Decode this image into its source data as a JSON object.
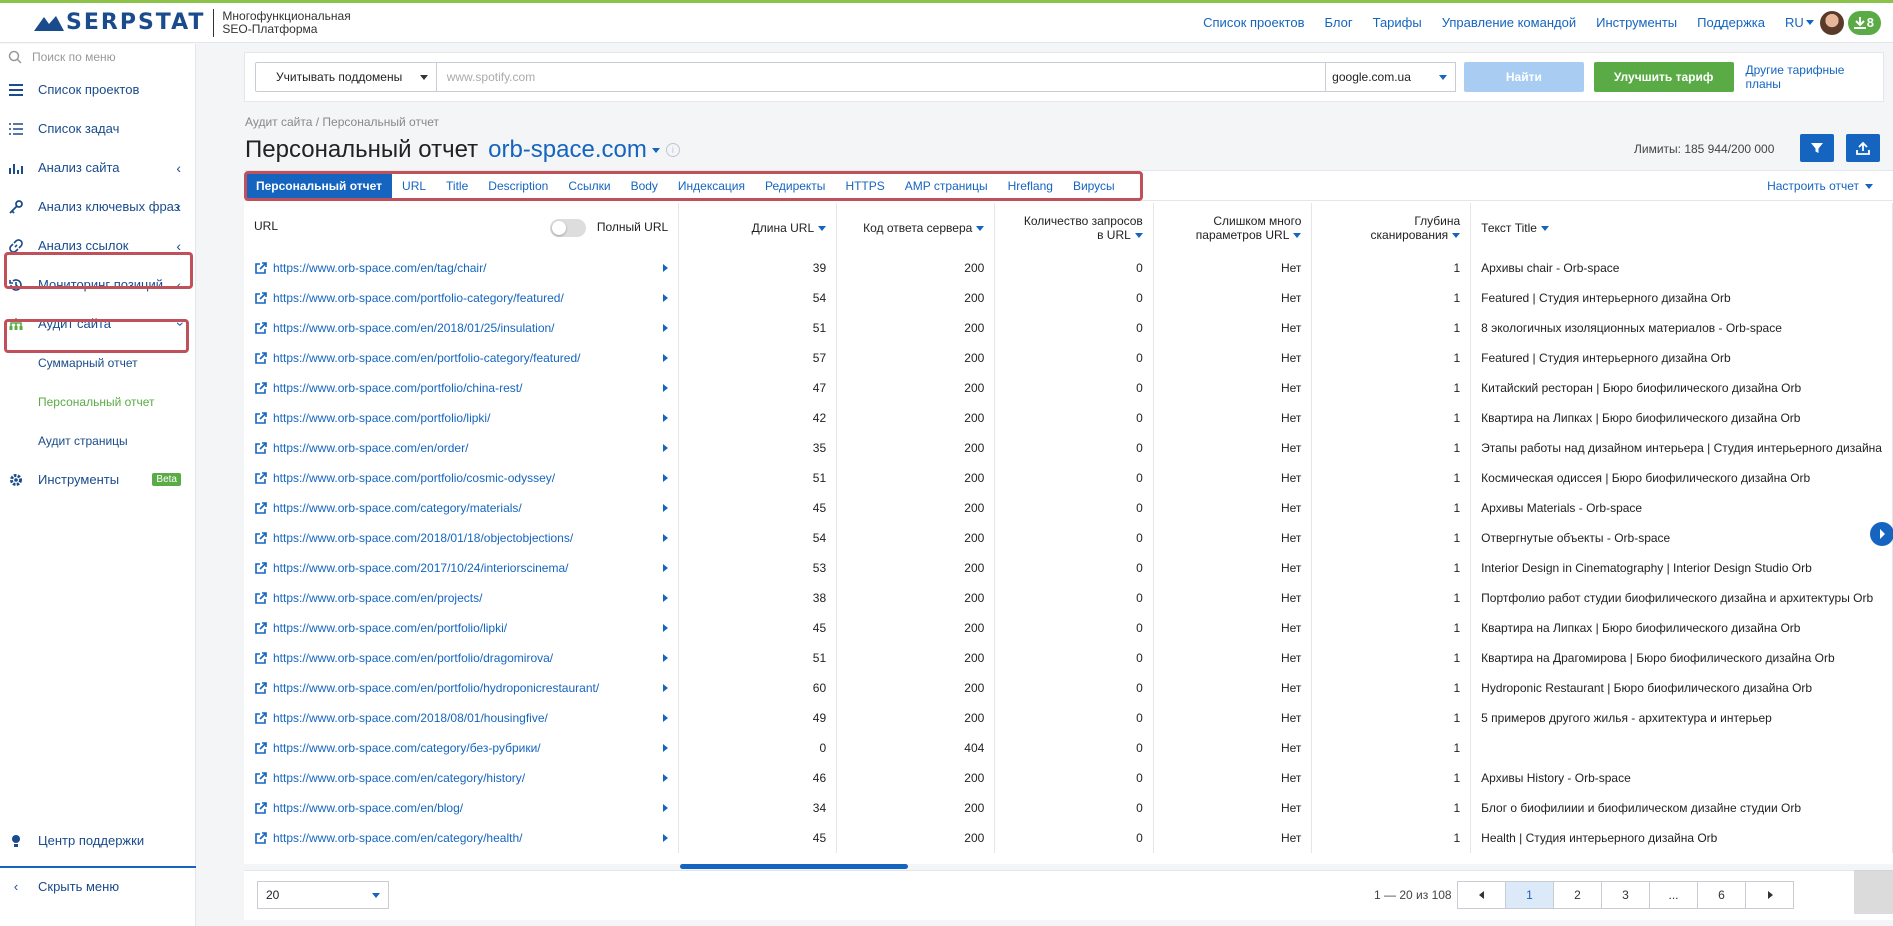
{
  "header": {
    "brand": "SERPSTAT",
    "tagline_1": "Многофункциональная",
    "tagline_2": "SEO-Платформа",
    "nav": [
      "Список проектов",
      "Блог",
      "Тарифы",
      "Управление командой",
      "Инструменты",
      "Поддержка"
    ],
    "lang": "RU",
    "downloads_count": "8"
  },
  "sidebar": {
    "search_placeholder": "Поиск по меню",
    "items": [
      {
        "label": "Список проектов",
        "icon": "list-icon"
      },
      {
        "label": "Список задач",
        "icon": "tasks-icon"
      },
      {
        "label": "Анализ сайта",
        "icon": "site-analysis-icon"
      },
      {
        "label": "Анализ ключевых фраз",
        "icon": "key-icon"
      },
      {
        "label": "Анализ ссылок",
        "icon": "link-icon"
      },
      {
        "label": "Мониторинг позиций",
        "icon": "history-icon"
      },
      {
        "label": "Аудит сайта",
        "icon": "sitemap-icon"
      }
    ],
    "sub_items": [
      "Суммарный отчет",
      "Персональный отчет",
      "Аудит страницы"
    ],
    "tools": "Инструменты",
    "beta": "Beta",
    "support": "Центр поддержки",
    "hide_menu": "Скрыть меню"
  },
  "searchbar": {
    "subdomains": "Учитывать поддомены",
    "domain_placeholder": "www.spotify.com",
    "engine": "google.com.ua",
    "find": "Найти",
    "upgrade": "Улучшить тариф",
    "other_plans": "Другие тарифные планы"
  },
  "page": {
    "breadcrumb": "Аудит сайта / Персональный отчет",
    "title": "Персональный отчет",
    "domain": "orb-space.com",
    "limits": "Лимиты: 185 944/200 000"
  },
  "tabs": [
    "Персональный отчет",
    "URL",
    "Title",
    "Description",
    "Ссылки",
    "Body",
    "Индексация",
    "Редиректы",
    "HTTPS",
    "AMP страницы",
    "Hreflang",
    "Вирусы"
  ],
  "configure": "Настроить отчет",
  "table": {
    "headers": {
      "url": "URL",
      "full_url": "Полный URL",
      "url_length": "Длина URL",
      "status": "Код ответа сервера",
      "params_1": "Количество запросов",
      "params_2": "в URL",
      "many_1": "Слишком много",
      "many_2": "параметров URL",
      "depth_1": "Глубина",
      "depth_2": "сканирования",
      "title": "Текст Title"
    },
    "rows": [
      [
        "https://www.orb-space.com/en/tag/chair/",
        "39",
        "200",
        "0",
        "Нет",
        "1",
        "Архивы chair - Orb-space"
      ],
      [
        "https://www.orb-space.com/portfolio-category/featured/",
        "54",
        "200",
        "0",
        "Нет",
        "1",
        "Featured | Студия интерьерного дизайна Orb"
      ],
      [
        "https://www.orb-space.com/en/2018/01/25/insulation/",
        "51",
        "200",
        "0",
        "Нет",
        "1",
        "8 экологичных изоляционных материалов - Orb-space"
      ],
      [
        "https://www.orb-space.com/en/portfolio-category/featured/",
        "57",
        "200",
        "0",
        "Нет",
        "1",
        "Featured | Студия интерьерного дизайна Orb"
      ],
      [
        "https://www.orb-space.com/portfolio/china-rest/",
        "47",
        "200",
        "0",
        "Нет",
        "1",
        "Китайский ресторан | Бюро биофилического дизайна Orb"
      ],
      [
        "https://www.orb-space.com/portfolio/lipki/",
        "42",
        "200",
        "0",
        "Нет",
        "1",
        "Квартира на Липках | Бюро биофилического дизайна Orb"
      ],
      [
        "https://www.orb-space.com/en/order/",
        "35",
        "200",
        "0",
        "Нет",
        "1",
        "Этапы работы над дизайном интерьера | Студия интерьерного дизайна"
      ],
      [
        "https://www.orb-space.com/portfolio/cosmic-odyssey/",
        "51",
        "200",
        "0",
        "Нет",
        "1",
        "Космическая одиссея | Бюро биофилического дизайна Orb"
      ],
      [
        "https://www.orb-space.com/category/materials/",
        "45",
        "200",
        "0",
        "Нет",
        "1",
        "Архивы Materials - Orb-space"
      ],
      [
        "https://www.orb-space.com/2018/01/18/objectobjections/",
        "54",
        "200",
        "0",
        "Нет",
        "1",
        "Отвергнутые объекты - Orb-space"
      ],
      [
        "https://www.orb-space.com/2017/10/24/interiorscinema/",
        "53",
        "200",
        "0",
        "Нет",
        "1",
        "Interior Design in Cinematography | Interior Design Studio Orb"
      ],
      [
        "https://www.orb-space.com/en/projects/",
        "38",
        "200",
        "0",
        "Нет",
        "1",
        "Портфолио работ студии биофилического дизайна и архитектуры Orb"
      ],
      [
        "https://www.orb-space.com/en/portfolio/lipki/",
        "45",
        "200",
        "0",
        "Нет",
        "1",
        "Квартира на Липках | Бюро биофилического дизайна Orb"
      ],
      [
        "https://www.orb-space.com/en/portfolio/dragomirova/",
        "51",
        "200",
        "0",
        "Нет",
        "1",
        "Квартира на Драгомирова | Бюро биофилического дизайна Orb"
      ],
      [
        "https://www.orb-space.com/en/portfolio/hydroponicrestaurant/",
        "60",
        "200",
        "0",
        "Нет",
        "1",
        "Hydroponic Restaurant | Бюро биофилического дизайна Orb"
      ],
      [
        "https://www.orb-space.com/2018/08/01/housingfive/",
        "49",
        "200",
        "0",
        "Нет",
        "1",
        "5 примеров другого жилья - архитектура и интерьер"
      ],
      [
        "https://www.orb-space.com/category/без-рубрики/",
        "0",
        "404",
        "0",
        "Нет",
        "1",
        ""
      ],
      [
        "https://www.orb-space.com/en/category/history/",
        "46",
        "200",
        "0",
        "Нет",
        "1",
        "Архивы History - Orb-space"
      ],
      [
        "https://www.orb-space.com/en/blog/",
        "34",
        "200",
        "0",
        "Нет",
        "1",
        "Блог о биофилиии и биофилическом дизайне студии Orb"
      ],
      [
        "https://www.orb-space.com/en/category/health/",
        "45",
        "200",
        "0",
        "Нет",
        "1",
        "Health | Студия интерьерного дизайна Orb"
      ]
    ]
  },
  "footer": {
    "per_page": "20",
    "range": "1 — 20 из 108",
    "pages": [
      "1",
      "2",
      "3",
      "...",
      "6"
    ]
  },
  "colors": {
    "brand_blue": "#1565c0",
    "green": "#5aab46",
    "highlight": "#c0505a"
  }
}
